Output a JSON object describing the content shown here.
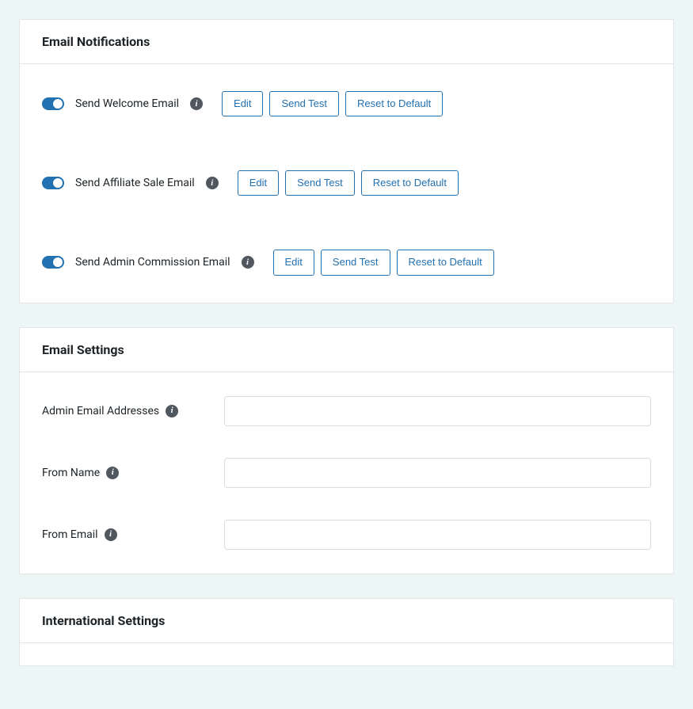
{
  "notifications": {
    "title": "Email Notifications",
    "rows": [
      {
        "label": "Send Welcome Email",
        "edit": "Edit",
        "sendTest": "Send Test",
        "reset": "Reset to Default"
      },
      {
        "label": "Send Affiliate Sale Email",
        "edit": "Edit",
        "sendTest": "Send Test",
        "reset": "Reset to Default"
      },
      {
        "label": "Send Admin Commission Email",
        "edit": "Edit",
        "sendTest": "Send Test",
        "reset": "Reset to Default"
      }
    ]
  },
  "emailSettings": {
    "title": "Email Settings",
    "fields": [
      {
        "label": "Admin Email Addresses",
        "value": ""
      },
      {
        "label": "From Name",
        "value": ""
      },
      {
        "label": "From Email",
        "value": ""
      }
    ]
  },
  "international": {
    "title": "International Settings"
  },
  "info_glyph": "i"
}
